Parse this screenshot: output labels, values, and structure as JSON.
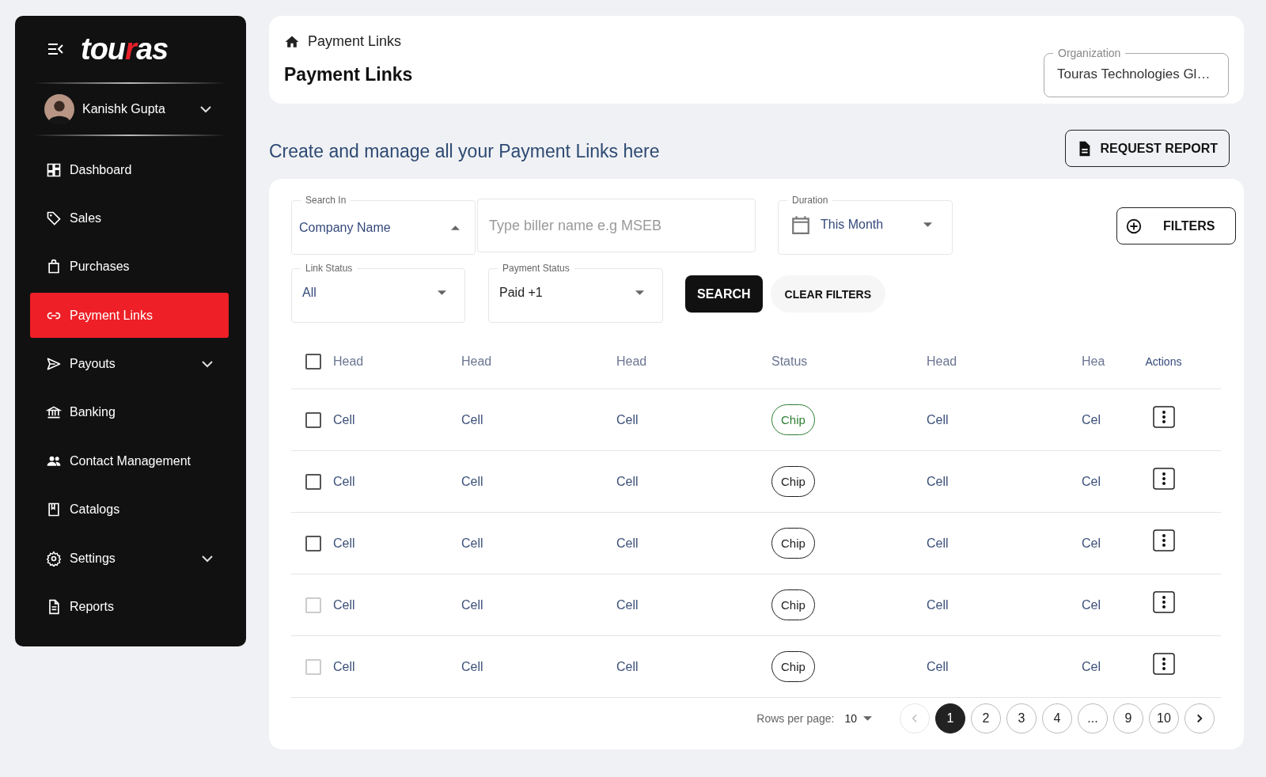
{
  "sidebar": {
    "logo": [
      {
        "text": "tou",
        "accent": false
      },
      {
        "text": "r",
        "accent": true
      },
      {
        "text": "as",
        "accent": false
      }
    ],
    "user": {
      "name": "Kanishk Gupta",
      "expanded": false
    },
    "items": [
      {
        "label": "Dashboard",
        "selected": false,
        "expandable": false
      },
      {
        "label": "Sales",
        "selected": false,
        "expandable": false
      },
      {
        "label": "Purchases",
        "selected": false,
        "expandable": false
      },
      {
        "label": "Payment Links",
        "selected": true,
        "expandable": false
      },
      {
        "label": "Payouts",
        "selected": false,
        "expandable": true
      },
      {
        "label": "Banking",
        "selected": false,
        "expandable": false
      },
      {
        "label": "Contact Management",
        "selected": false,
        "expandable": false
      },
      {
        "label": "Catalogs",
        "selected": false,
        "expandable": false
      },
      {
        "label": "Settings",
        "selected": false,
        "expandable": true
      },
      {
        "label": "Reports",
        "selected": false,
        "expandable": false
      }
    ]
  },
  "header": {
    "breadcrumb": "Payment Links",
    "title": "Payment Links",
    "organization": {
      "label": "Organization",
      "value": "Touras Technologies Gl…"
    }
  },
  "page": {
    "heading": "Create and manage all your Payment Links here",
    "request_button": "REQUEST REPORT"
  },
  "filters": {
    "search_in": {
      "label": "Search In",
      "value": "Company Name",
      "open": true
    },
    "search": {
      "placeholder": "Type biller name e.g MSEB"
    },
    "duration": {
      "label": "Duration",
      "value": "This Month",
      "open": false
    },
    "filters_button": "FILTERS",
    "link_status": {
      "label": "Link Status",
      "value": "All",
      "open": false
    },
    "payment_status": {
      "label": "Payment Status",
      "value": "Paid +1",
      "open": false
    },
    "search_button": "SEARCH",
    "clear_button": "CLEAR FILTERS"
  },
  "table": {
    "columns": [
      "Head",
      "Head",
      "Head",
      "Status",
      "Head",
      "Hea",
      "Actions"
    ],
    "header_checked": false,
    "rows": [
      {
        "checked": false,
        "disabled": false,
        "cells": [
          "Cell",
          "Cell",
          "Cell",
          "Chip",
          "Cell",
          "Cel"
        ],
        "color": "#2e7d32"
      },
      {
        "checked": false,
        "disabled": false,
        "cells": [
          "Cell",
          "Cell",
          "Cell",
          "Chip",
          "Cell",
          "Cel"
        ],
        "color": "#212121"
      },
      {
        "checked": false,
        "disabled": false,
        "cells": [
          "Cell",
          "Cell",
          "Cell",
          "Chip",
          "Cell",
          "Cel"
        ],
        "color": "#212121"
      },
      {
        "checked": false,
        "disabled": true,
        "cells": [
          "Cell",
          "Cell",
          "Cell",
          "Chip",
          "Cell",
          "Cel"
        ],
        "color": "#212121"
      },
      {
        "checked": false,
        "disabled": true,
        "cells": [
          "Cell",
          "Cell",
          "Cell",
          "Chip",
          "Cell",
          "Cel"
        ],
        "color": "#212121"
      }
    ]
  },
  "pagination": {
    "rows_label": "Rows per page:",
    "rows_value": "10",
    "prev_disabled": true,
    "pages": [
      {
        "label": "1",
        "selected": true
      },
      {
        "label": "2",
        "selected": false
      },
      {
        "label": "3",
        "selected": false
      },
      {
        "label": "4",
        "selected": false
      },
      {
        "label": "...",
        "selected": false
      },
      {
        "label": "9",
        "selected": false
      },
      {
        "label": "10",
        "selected": false
      }
    ]
  }
}
